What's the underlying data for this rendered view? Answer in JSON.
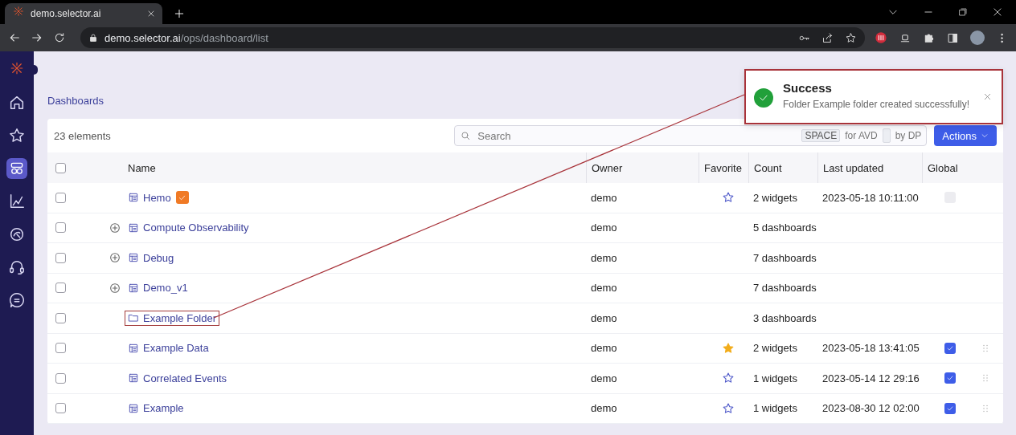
{
  "browser": {
    "tab_title": "demo.selector.ai",
    "url_host": "demo.selector.ai",
    "url_path": "/ops/dashboard/list"
  },
  "sidebar": {
    "items": [
      {
        "kind": "home",
        "selected": false
      },
      {
        "kind": "star",
        "selected": false
      },
      {
        "kind": "dashboards",
        "selected": true
      },
      {
        "kind": "chart",
        "selected": false
      },
      {
        "kind": "analytics",
        "selected": false
      },
      {
        "kind": "support",
        "selected": false
      },
      {
        "kind": "chat",
        "selected": false
      }
    ]
  },
  "breadcrumb": "Dashboards",
  "count_label": "23 elements",
  "search": {
    "placeholder": "Search",
    "hint_key": "SPACE",
    "hint_text": "for AVD",
    "hint_text_2": "by DP"
  },
  "actions_button": "Actions",
  "table": {
    "select_all_checked": false,
    "columns": [
      "Name",
      "Owner",
      "Favorite",
      "Count",
      "Last updated",
      "Global"
    ],
    "rows": [
      {
        "kind": "dashboard",
        "name": "Hemo",
        "expandable": false,
        "verified": true,
        "highlighted": false,
        "checked": false,
        "owner": "demo",
        "favorite": false,
        "count": "2 widgets",
        "updated": "2023-05-18 10:11:00",
        "global": false,
        "draggable": false
      },
      {
        "kind": "dashboard",
        "name": "Compute Observability",
        "expandable": true,
        "verified": false,
        "highlighted": false,
        "checked": false,
        "owner": "demo",
        "count": "5 dashboards"
      },
      {
        "kind": "dashboard",
        "name": "Debug",
        "expandable": true,
        "verified": false,
        "highlighted": false,
        "checked": false,
        "owner": "demo",
        "count": "7 dashboards"
      },
      {
        "kind": "dashboard",
        "name": "Demo_v1",
        "expandable": true,
        "verified": false,
        "highlighted": false,
        "checked": false,
        "owner": "demo",
        "count": "7 dashboards"
      },
      {
        "kind": "folder",
        "name": "Example Folder",
        "expandable": false,
        "verified": false,
        "highlighted": true,
        "checked": false,
        "owner": "demo",
        "count": "3 dashboards"
      },
      {
        "kind": "dashboard",
        "name": "Example Data",
        "expandable": false,
        "verified": false,
        "highlighted": false,
        "checked": false,
        "owner": "demo",
        "favorite": true,
        "count": "2 widgets",
        "updated": "2023-05-18 13:41:05",
        "global": true,
        "draggable": true
      },
      {
        "kind": "dashboard",
        "name": "Correlated Events",
        "expandable": false,
        "verified": false,
        "highlighted": false,
        "checked": false,
        "owner": "demo",
        "favorite": false,
        "count": "1 widgets",
        "updated": "2023-05-14 12 29:16",
        "global": true,
        "draggable": true
      },
      {
        "kind": "dashboard",
        "name": "Example",
        "expandable": false,
        "verified": false,
        "highlighted": false,
        "checked": false,
        "owner": "demo",
        "favorite": false,
        "count": "1 widgets",
        "updated": "2023-08-30 12 02:00",
        "global": true,
        "draggable": true
      }
    ]
  },
  "toast": {
    "title": "Success",
    "message": "Folder Example folder created successfully!"
  }
}
